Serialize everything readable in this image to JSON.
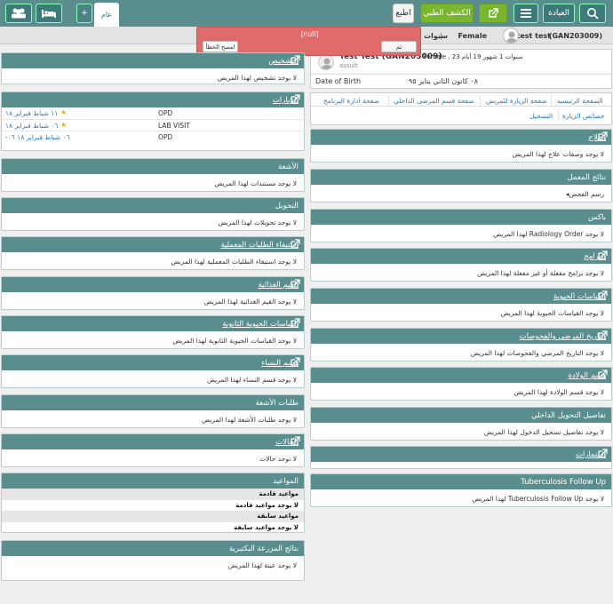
{
  "topbar": {
    "people_icon": "people-icon",
    "bed_icon": "bed-icon",
    "add_tab": "+",
    "tab_general": "عام",
    "print": "اطبع",
    "exam": "الكشف الطبي",
    "clinic": "العيادة"
  },
  "patient": {
    "id": "(GAN203009)",
    "name": "test test",
    "gender": "Female",
    "age": "سنوات 1"
  },
  "popup": {
    "title": "[null]",
    "ok": "تم",
    "clear": "امسح الخطأ"
  },
  "header_card": {
    "name": "Test Test (GAN203009)",
    "meta": "سنوات 1 شهور 19 أيام 23 , Female -",
    "sub": "assult",
    "dob_label": "Date of Birth",
    "dob_value": "٠٨ كانون الثاني يناير ٩٥"
  },
  "nav": {
    "r1": [
      "الصفحة الرئيسيه",
      "صفحة الزيارة للمريض",
      "صفحة قسم المرضى الداخلي",
      "صفحة ادارة البرنامج"
    ],
    "r2": [
      "خصائص الزيارة",
      "التسجيل"
    ]
  },
  "left": [
    {
      "title": "التشخيص",
      "body": "لا يوجد تشخيص لهذا المريض",
      "ext": true
    },
    {
      "title": "الزيارات",
      "ext": true,
      "visits": [
        {
          "date": "١١ شباط فبراير ١٨",
          "type": "OPD",
          "star": true
        },
        {
          "date": "٠٦ شباط فبراير ١٨",
          "type": "LAB VISIT",
          "star": true
        },
        {
          "date": "٠٦ شباط فبراير ١٨ ٠٦-",
          "type": "OPD",
          "star": false
        }
      ]
    },
    {
      "title": "الأشعة",
      "body": "لا يوجد مستندات لهذا المريض",
      "ext": false
    },
    {
      "title": "التحويل",
      "body": "لا يوجد تحويلات لهذا المريض",
      "ext": false
    },
    {
      "title": "استيفاء الطلبات المعملية",
      "body": "لا يوجد استيفاء الطلبات المعملية لهذا المريض",
      "ext": true
    },
    {
      "title": "القيم الغذائية",
      "body": "لا يوجد القيم الغذائية لهذا المريض",
      "ext": true
    },
    {
      "title": "القياسات الحيوية الثانوية",
      "body": "لا يوجد القياسات الحيوية الثانوية لهذا المريض",
      "ext": true
    },
    {
      "title": "قسم النساء",
      "body": "لا يوجد قسم النساء لهذا المريض",
      "ext": true
    },
    {
      "title": "طلبات الأشعة",
      "body": "لا يوجد طلبات الأشعة لهذا المريض",
      "ext": false
    },
    {
      "title": "الحالات",
      "body": "لا توجد حالات",
      "ext": true
    },
    {
      "title": "المواعيد",
      "ext": false,
      "appts": [
        "مواعيد قادمة",
        "لا يوجد مواعيد قادمة",
        "مواعيد سابقة",
        "لا يوجد مواعيد سابقة"
      ]
    },
    {
      "title": "نتائج المزرعة البكتيرية",
      "body": "لا يوجد عينة لهذا المريض",
      "ext": false
    }
  ],
  "right": [
    {
      "title": "العلاج",
      "body": "لا يوجد وصفات علاج لهذا المريض",
      "ext": true
    },
    {
      "title": "نتائج المعمل",
      "body": "رسم الفحص",
      "ext": false,
      "chev": true
    },
    {
      "title": "باكس",
      "body": "لا يوجد Radiology Order لهذا المريض",
      "ext": false
    },
    {
      "title": "البرامج",
      "body": "لا يوجد برامج مفعلة أو غير مفعلة لهذا المريض",
      "ext": true
    },
    {
      "title": "القياسات الحيوية",
      "body": "لا يوجد القياسات الحيوية لهذا المريض",
      "ext": true
    },
    {
      "title": "التاريخ المرضي والفحوصات",
      "body": "لا يوجد التاريخ المرضي والفحوصات لهذا المريض",
      "ext": true
    },
    {
      "title": "قسم الولادة",
      "body": "لا يوجد قسم الولادة لهذا المريض",
      "ext": true
    },
    {
      "title": "تفاصيل التحويل الداخلي",
      "body": "لا يوجد تفاصيل تسجيل الدخول لهذا المريض",
      "ext": false
    },
    {
      "title": "استمارات",
      "body": "",
      "ext": true
    },
    {
      "title": "Tuberculosis Follow Up",
      "body": "لا يوجد Tuberculosis Follow Up لهذا المريض",
      "ext": false
    }
  ]
}
